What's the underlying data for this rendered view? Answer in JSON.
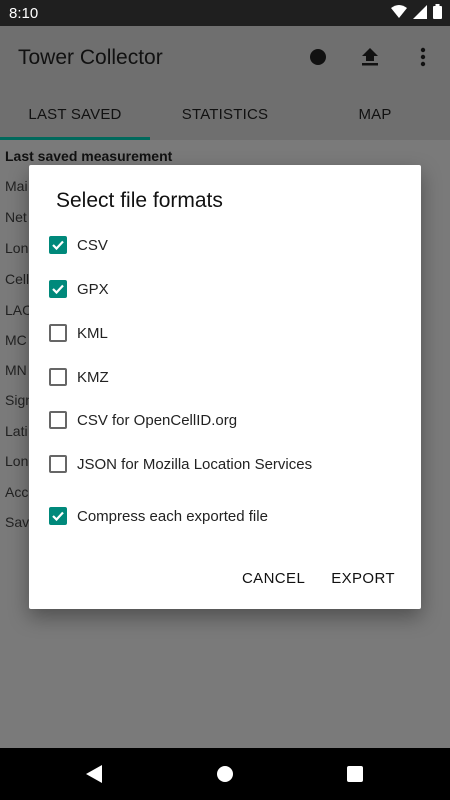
{
  "status_bar": {
    "time": "8:10"
  },
  "app_bar": {
    "title": "Tower Collector"
  },
  "tabs": [
    {
      "label": "LAST SAVED",
      "active": true
    },
    {
      "label": "STATISTICS",
      "active": false
    },
    {
      "label": "MAP",
      "active": false
    }
  ],
  "content": {
    "heading": "Last saved measurement",
    "row_labels": [
      "Mai",
      "Net",
      "Lon",
      "Cell",
      "LAC",
      "MC",
      "MN",
      "Sign",
      "Lati",
      "Lon",
      "Acc",
      "Sav"
    ]
  },
  "dialog": {
    "title": "Select file formats",
    "options": [
      {
        "label": "CSV",
        "checked": true
      },
      {
        "label": "GPX",
        "checked": true
      },
      {
        "label": "KML",
        "checked": false
      },
      {
        "label": "KMZ",
        "checked": false
      },
      {
        "label": "CSV for OpenCellID.org",
        "checked": false
      },
      {
        "label": "JSON for Mozilla Location Services",
        "checked": false
      },
      {
        "label": "Compress each exported file",
        "checked": true
      }
    ],
    "cancel_label": "CANCEL",
    "export_label": "EXPORT"
  },
  "colors": {
    "accent": "#00897b",
    "tab_indicator": "#00695c"
  }
}
